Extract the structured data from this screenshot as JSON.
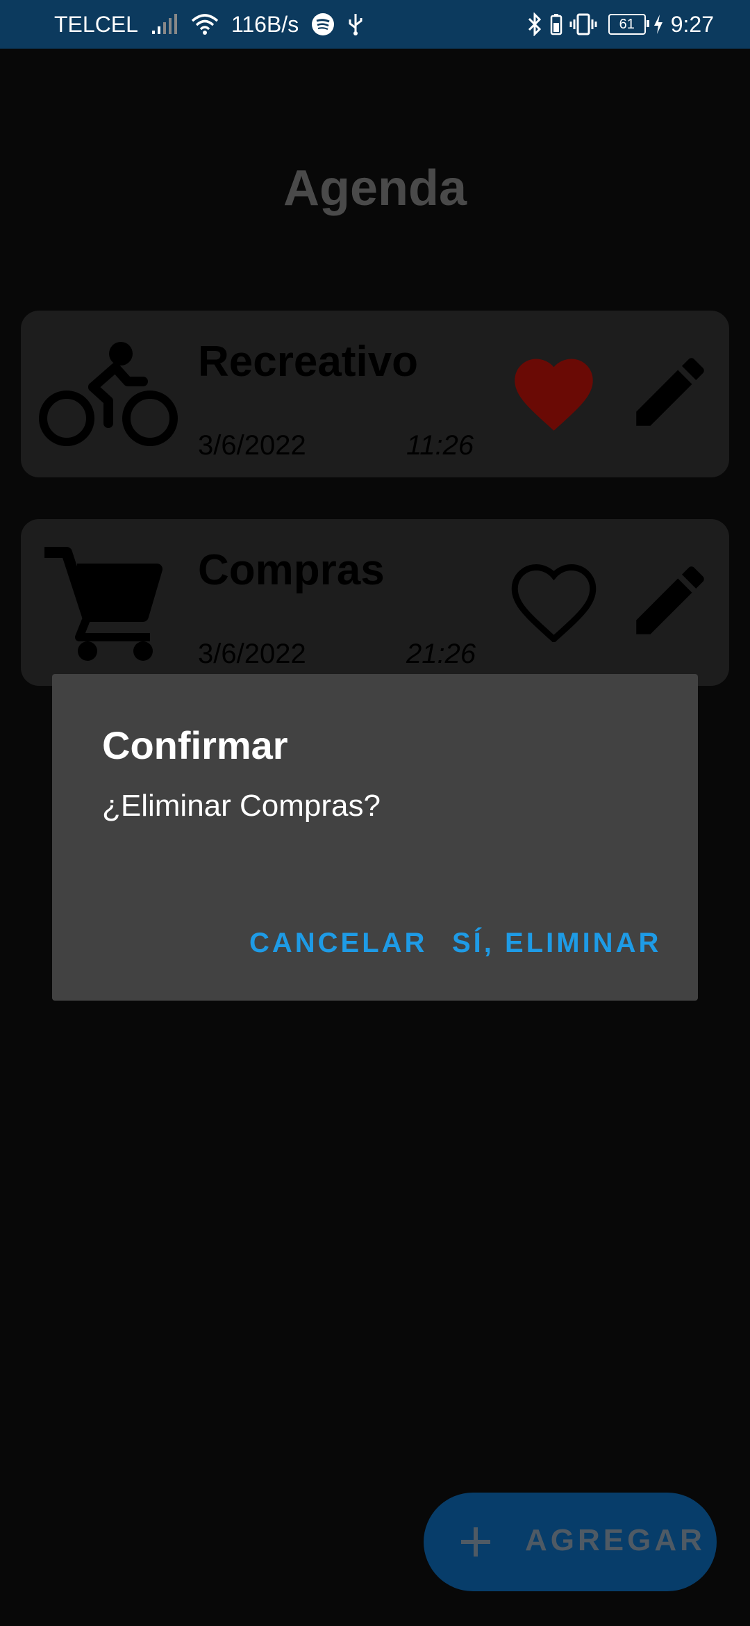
{
  "status_bar": {
    "carrier": "TELCEL",
    "speed": "116B/s",
    "battery": "61",
    "time": "9:27"
  },
  "page": {
    "title": "Agenda"
  },
  "cards": [
    {
      "title": "Recreativo",
      "date": "3/6/2022",
      "time": "11:26",
      "icon": "bicycle-icon",
      "favorite": true
    },
    {
      "title": "Compras",
      "date": "3/6/2022",
      "time": "21:26",
      "icon": "cart-icon",
      "favorite": false
    }
  ],
  "dialog": {
    "title": "Confirmar",
    "message": "¿Eliminar Compras?",
    "cancel_label": "CANCELAR",
    "confirm_label": "SÍ, ELIMINAR"
  },
  "fab": {
    "label": "AGREGAR",
    "icon": "plus-icon"
  },
  "colors": {
    "status_bar": "#0c3a5e",
    "dialog_button": "#1e9be6",
    "favorite": "#6a0a05",
    "fab": "#073d6a"
  }
}
